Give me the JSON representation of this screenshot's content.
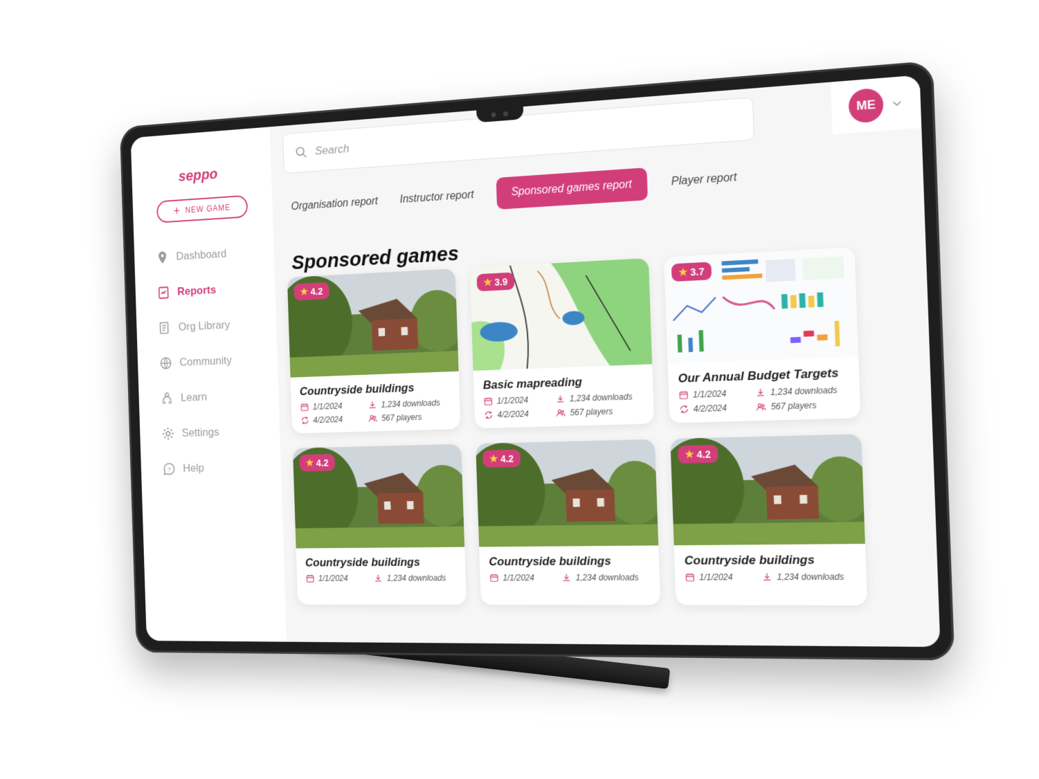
{
  "brand": {
    "logo": "seppo",
    "accent": "#d23e7a"
  },
  "sidebar": {
    "new_game_label": "NEW GAME",
    "items": [
      {
        "label": "Dashboard",
        "icon": "pin-icon",
        "active": false
      },
      {
        "label": "Reports",
        "icon": "report-icon",
        "active": true
      },
      {
        "label": "Org Library",
        "icon": "library-icon",
        "active": false
      },
      {
        "label": "Community",
        "icon": "globe-icon",
        "active": false
      },
      {
        "label": "Learn",
        "icon": "learn-icon",
        "active": false
      },
      {
        "label": "Settings",
        "icon": "gear-icon",
        "active": false
      },
      {
        "label": "Help",
        "icon": "help-icon",
        "active": false
      }
    ]
  },
  "search": {
    "placeholder": "Search"
  },
  "user": {
    "initials": "ME"
  },
  "tabs": [
    {
      "label": "Organisation report",
      "active": false
    },
    {
      "label": "Instructor report",
      "active": false
    },
    {
      "label": "Sponsored games report",
      "active": true
    },
    {
      "label": "Player report",
      "active": false
    }
  ],
  "page": {
    "title": "Sponsored games"
  },
  "cards": [
    {
      "title": "Countryside buildings",
      "rating": "4.2",
      "image": "countryside-house",
      "created": "1/1/2024",
      "updated": "4/2/2024",
      "downloads": "1,234 downloads",
      "players": "567 players"
    },
    {
      "title": "Basic mapreading",
      "rating": "3.9",
      "image": "topographic-map",
      "created": "1/1/2024",
      "updated": "4/2/2024",
      "downloads": "1,234 downloads",
      "players": "567 players"
    },
    {
      "title": "Our Annual Budget Targets",
      "rating": "3.7",
      "image": "budget-charts",
      "created": "1/1/2024",
      "updated": "4/2/2024",
      "downloads": "1,234 downloads",
      "players": "567 players"
    },
    {
      "title": "Countryside buildings",
      "rating": "4.2",
      "image": "countryside-house",
      "created": "1/1/2024",
      "updated": "",
      "downloads": "1,234 downloads",
      "players": ""
    },
    {
      "title": "Countryside buildings",
      "rating": "4.2",
      "image": "countryside-house",
      "created": "1/1/2024",
      "updated": "",
      "downloads": "1,234 downloads",
      "players": ""
    },
    {
      "title": "Countryside buildings",
      "rating": "4.2",
      "image": "countryside-house",
      "created": "1/1/2024",
      "updated": "",
      "downloads": "1,234 downloads",
      "players": ""
    }
  ]
}
